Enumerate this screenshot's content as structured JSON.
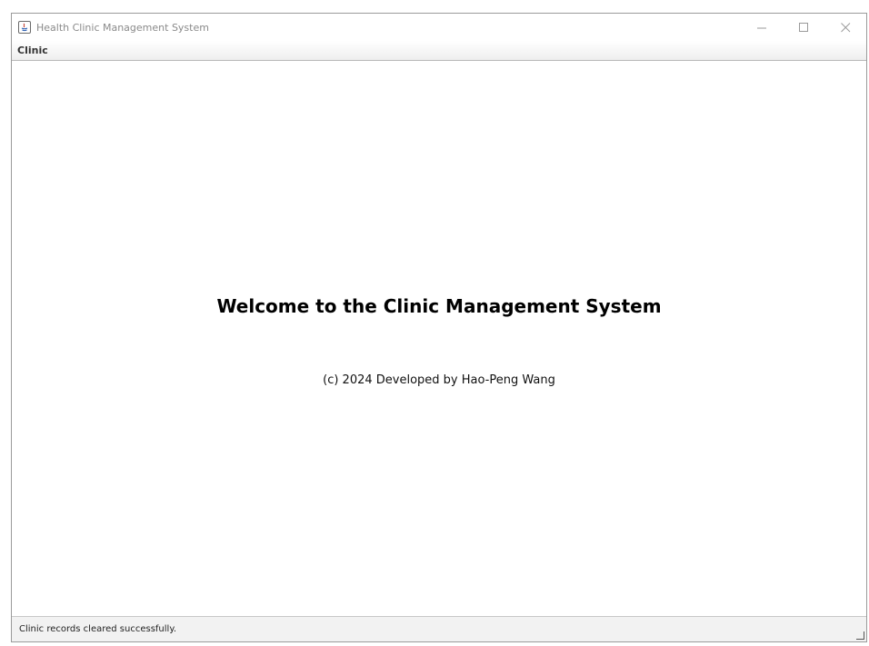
{
  "window": {
    "title": "Health Clinic Management System",
    "controls": {
      "minimize": "—",
      "maximize": "☐",
      "close": "✕"
    }
  },
  "menubar": {
    "items": [
      {
        "label": "Clinic"
      }
    ]
  },
  "main": {
    "welcome": "Welcome to the Clinic Management System",
    "copyright": "(c) 2024 Developed by Hao-Peng Wang"
  },
  "statusbar": {
    "message": "Clinic records cleared successfully."
  },
  "icons": {
    "app": "java-app-icon",
    "minimize": "minimize-icon",
    "maximize": "maximize-icon",
    "close": "close-icon"
  },
  "colors": {
    "title_text": "#8a8a8a",
    "status_bg": "#f2f2f2",
    "menu_bg": "#eeeeee"
  }
}
